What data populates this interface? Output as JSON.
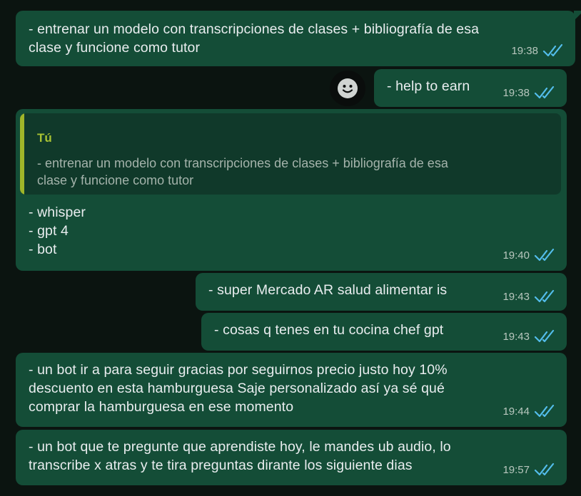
{
  "messages": [
    {
      "text": "- entrenar un modelo con transcripciones de clases + bibliografía de esa\nclase y funcione como tutor",
      "time": "19:38"
    },
    {
      "text": "- help to earn",
      "time": "19:38"
    },
    {
      "reply": {
        "author": "Tú",
        "text": "- entrenar un modelo con transcripciones de clases + bibliografía de esa\nclase y funcione como tutor"
      },
      "text": "- whisper\n- gpt 4\n- bot",
      "time": "19:40"
    },
    {
      "text": "- super Mercado AR salud alimentar is",
      "time": "19:43"
    },
    {
      "text": "- cosas q tenes en tu cocina chef gpt",
      "time": "19:43"
    },
    {
      "text": "- un bot ir a para seguir gracias por seguirnos precio justo hoy 10%\ndescuento en esta hamburguesa Saje personalizado así ya sé qué\ncomprar la hamburguesa en ese momento",
      "time": "19:44"
    },
    {
      "text": "- un bot que te pregunte que aprendiste hoy, le mandes ub audio, lo\ntranscribe x atras y te tira preguntas dirante los siguiente dias",
      "time": "19:57"
    }
  ],
  "status_icon": "double-check-read-icon",
  "colors": {
    "background": "#0b1410",
    "bubble": "#144d37",
    "quote_bg": "#10392a",
    "quote_bar": "#9fb529",
    "quote_author": "#a8c233",
    "read_ticks": "#53bdeb"
  }
}
